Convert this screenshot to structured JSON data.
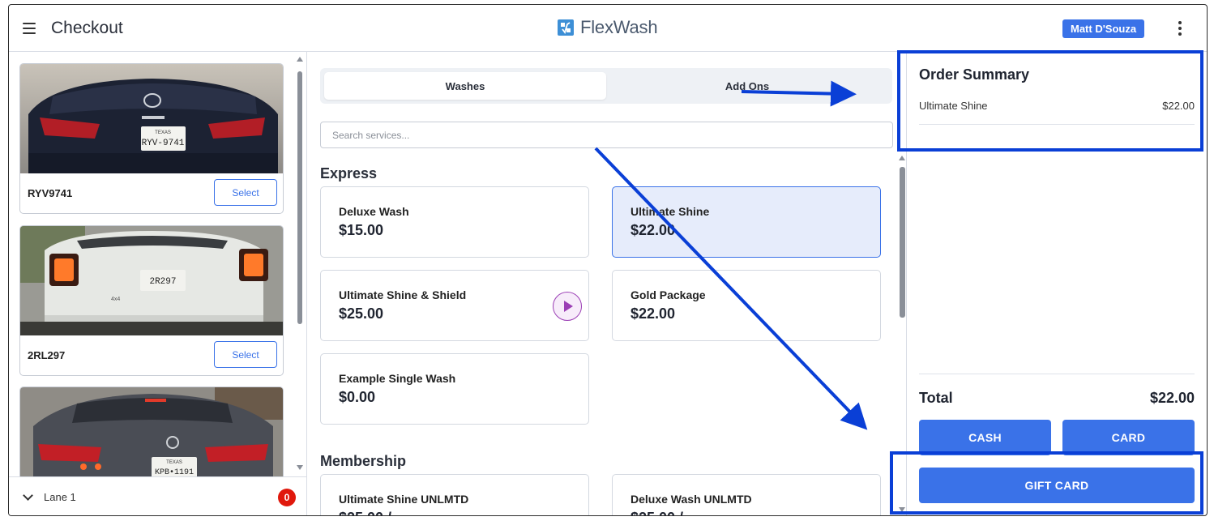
{
  "header": {
    "menu_icon": "hamburger-menu-icon",
    "title": "Checkout",
    "brand": "FlexWash",
    "brand_icon": "flexwash-logo-icon",
    "user": "Matt D'Souza",
    "more_icon": "vertical-dots-icon"
  },
  "vehicles": [
    {
      "plate": "RYV9741",
      "select_label": "Select",
      "photo_plate": "RYV-9741",
      "photo_state": "TEXAS",
      "color": "dark-blue sedan"
    },
    {
      "plate": "2RL297",
      "select_label": "Select",
      "photo_plate": "2R297",
      "photo_state": "TEXAS",
      "color": "white suv"
    },
    {
      "plate": "",
      "select_label": "Select",
      "photo_plate": "KPB•1191",
      "photo_state": "TEXAS",
      "color": "gray sedan"
    }
  ],
  "lane": {
    "label": "Lane 1",
    "count": "0"
  },
  "tabs": [
    {
      "label": "Washes",
      "active": true
    },
    {
      "label": "Add Ons",
      "active": false
    }
  ],
  "search": {
    "placeholder": "Search services..."
  },
  "sections": {
    "express": "Express",
    "membership": "Membership"
  },
  "services": [
    {
      "name": "Deluxe Wash",
      "price": "$15.00",
      "selected": false
    },
    {
      "name": "Ultimate Shine",
      "price": "$22.00",
      "selected": true
    },
    {
      "name": "Ultimate Shine & Shield",
      "price": "$25.00",
      "selected": false,
      "has_play": true
    },
    {
      "name": "Gold Package",
      "price": "$22.00",
      "selected": false
    },
    {
      "name": "Example Single Wash",
      "price": "$0.00",
      "selected": false
    }
  ],
  "memberships": [
    {
      "name": "Ultimate Shine UNLMTD",
      "price": "$25.00 /"
    },
    {
      "name": "Deluxe Wash UNLMTD",
      "price": "$25.00 /"
    }
  ],
  "order": {
    "title": "Order Summary",
    "items": [
      {
        "name": "Ultimate Shine",
        "price": "$22.00"
      }
    ],
    "total_label": "Total",
    "total_value": "$22.00",
    "cash_label": "CASH",
    "card_label": "CARD",
    "gift_label": "GIFT CARD"
  },
  "colors": {
    "accent": "#3a72e8",
    "selected_bg": "#e6ecfb",
    "badge_red": "#e0180c",
    "annotation_blue": "#0a3fd6",
    "play_purple": "#9b3fb5"
  }
}
